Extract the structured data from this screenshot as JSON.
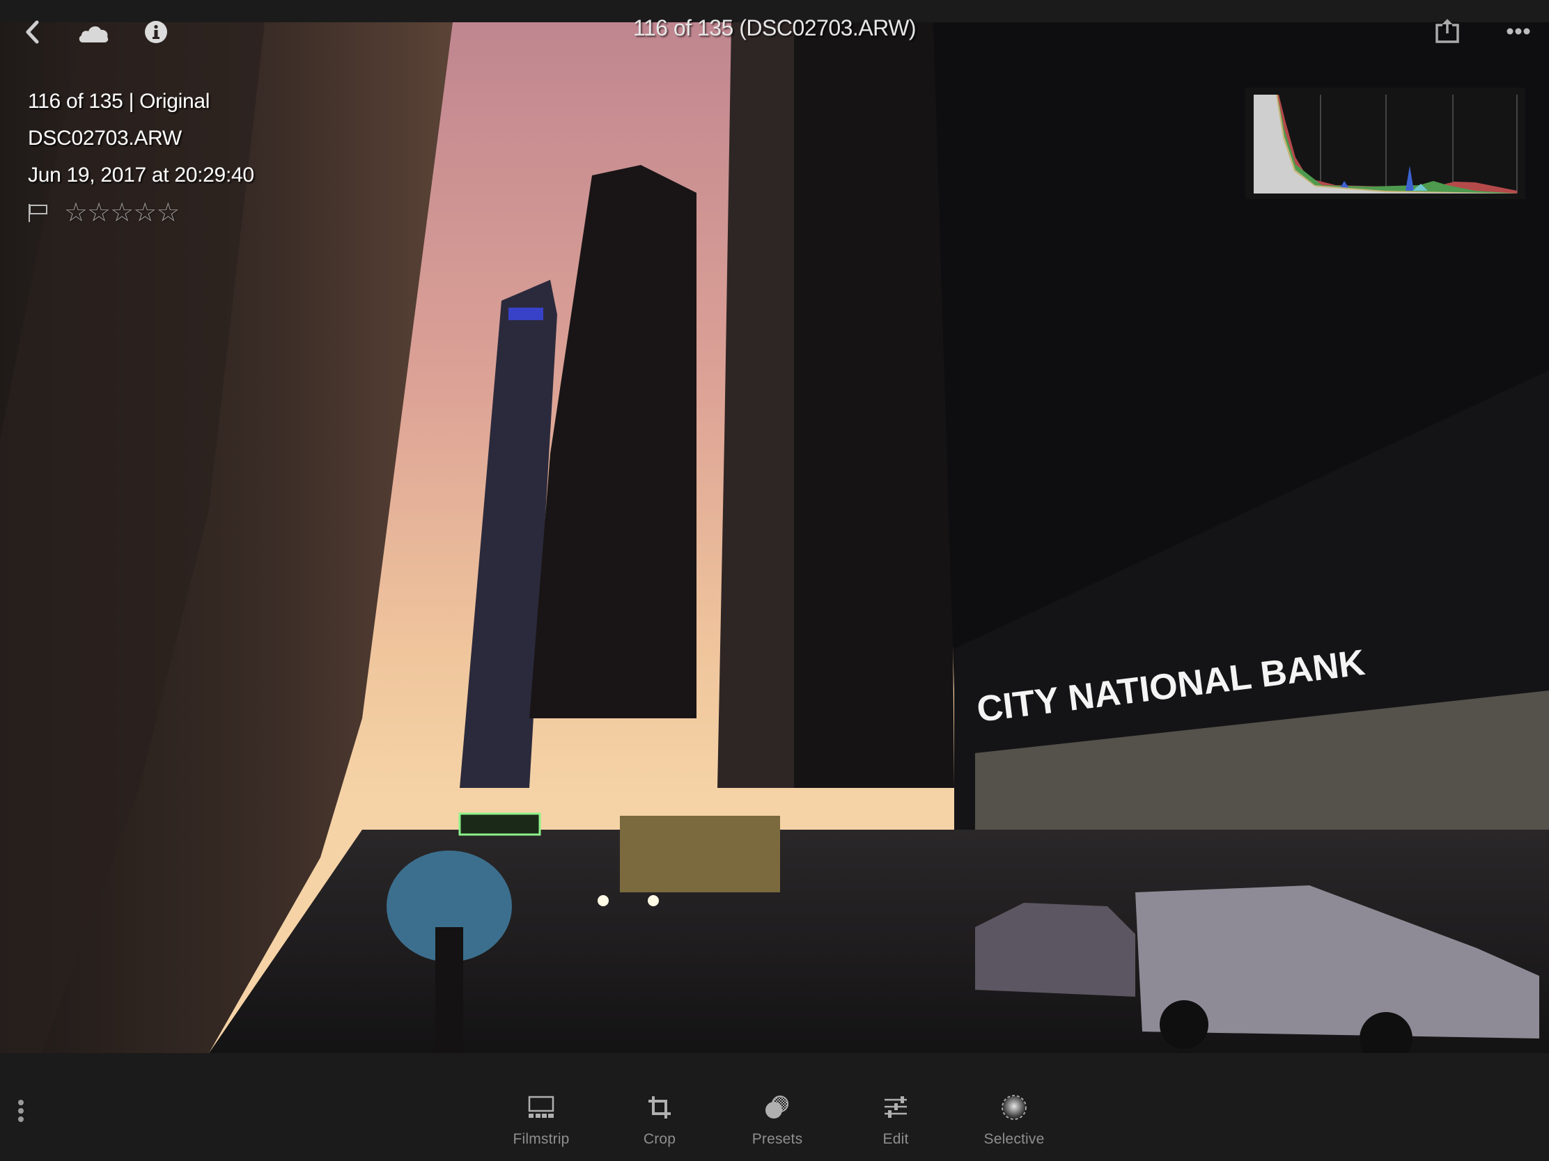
{
  "header": {
    "title": "116 of 135 (DSC02703.ARW)",
    "icons": {
      "back": "chevron-left-icon",
      "cloud": "cloud-icon",
      "info": "info-icon",
      "share": "share-icon",
      "more": "more-horizontal-icon"
    }
  },
  "info_overlay": {
    "position_line": "116 of 135 | Original",
    "filename": "DSC02703.ARW",
    "capture_date": "Jun 19, 2017 at 20:29:40",
    "flag": "unflagged",
    "rating": 0,
    "rating_max": 5,
    "star_glyph": "☆"
  },
  "histogram": {
    "label": "histogram",
    "channels": [
      "luminance",
      "red",
      "green",
      "blue",
      "yellow",
      "cyan"
    ]
  },
  "photo": {
    "description": "Rainy New York street at dusk with City National Bank signage",
    "signage_text": "CITY NATIONAL BANK"
  },
  "toolbar": {
    "items": [
      {
        "label": "Filmstrip",
        "icon": "filmstrip-icon"
      },
      {
        "label": "Crop",
        "icon": "crop-icon"
      },
      {
        "label": "Presets",
        "icon": "presets-icon"
      },
      {
        "label": "Edit",
        "icon": "sliders-icon"
      },
      {
        "label": "Selective",
        "icon": "selective-icon"
      }
    ],
    "more_icon": "more-vertical-icon"
  },
  "colors": {
    "bar_bg": "#1b1b1b",
    "toolbar_label": "#8f8f8f",
    "icon": "#b0b0b0"
  }
}
